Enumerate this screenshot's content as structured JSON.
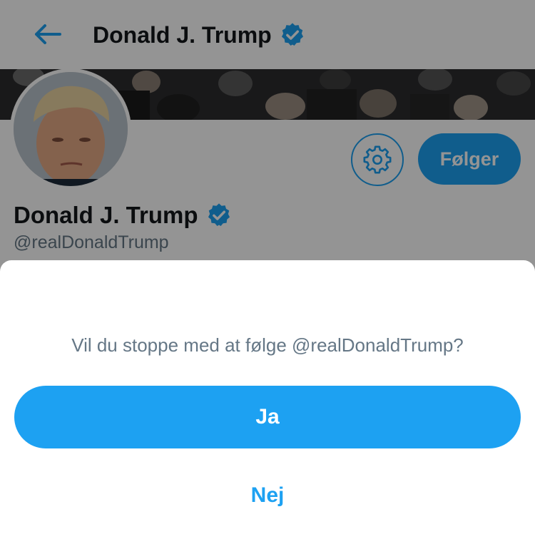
{
  "header": {
    "title": "Donald J. Trump",
    "back_icon": "arrow-left-icon",
    "verified_icon": "verified-badge-icon"
  },
  "profile": {
    "display_name": "Donald J. Trump",
    "handle": "@realDonaldTrump",
    "follow_button_label": "Følger",
    "settings_icon": "gear-icon"
  },
  "dialog": {
    "question": "Vil du stoppe med at følge @realDonaldTrump?",
    "confirm_label": "Ja",
    "cancel_label": "Nej"
  },
  "colors": {
    "accent": "#1da1f2",
    "text_primary": "#14171a",
    "text_secondary": "#657786"
  }
}
